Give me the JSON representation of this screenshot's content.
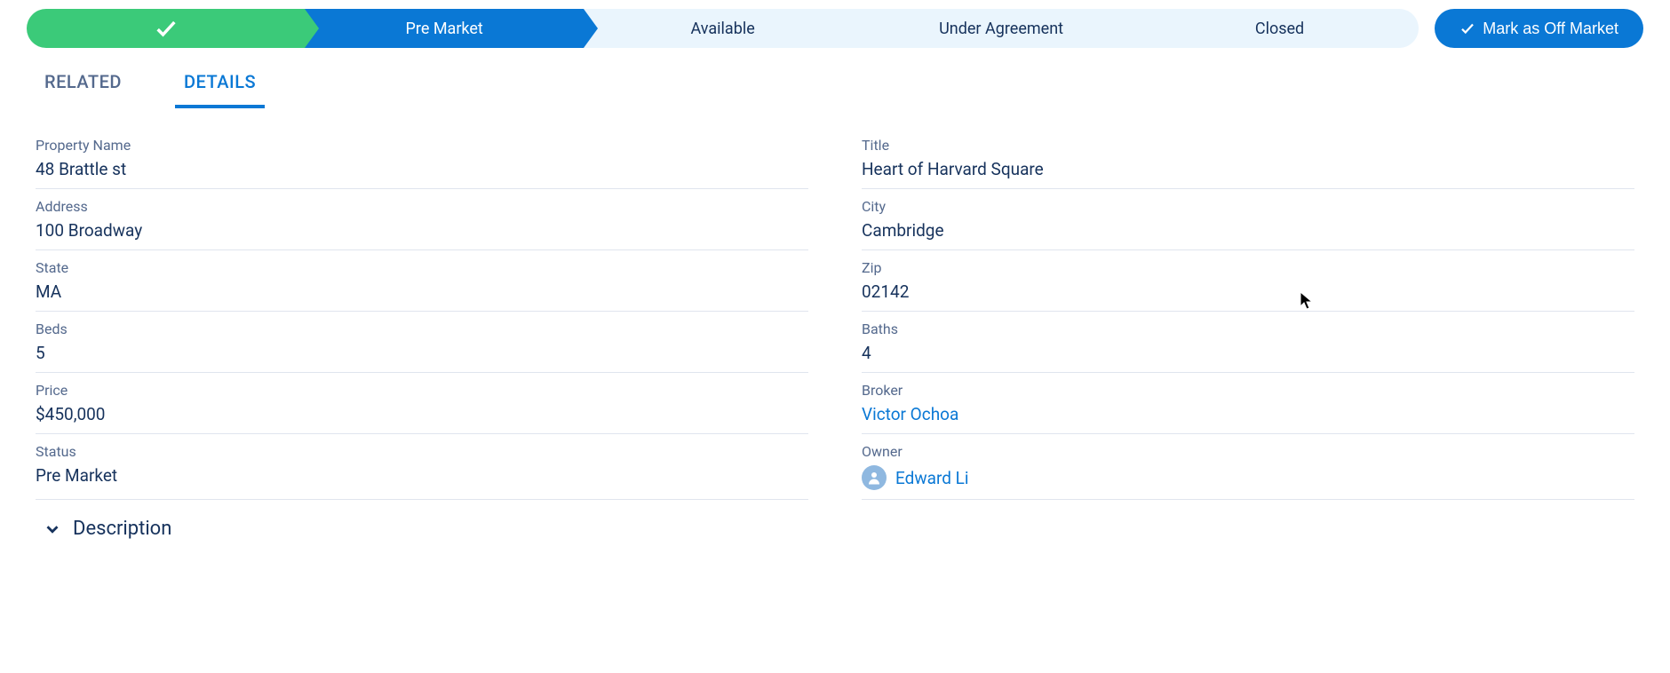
{
  "path": {
    "stages": [
      "",
      "Pre Market",
      "Available",
      "Under Agreement",
      "Closed"
    ],
    "complete_index": 0,
    "current_index": 1
  },
  "mark_button_label": "Mark as Off Market",
  "tabs": {
    "related": "RELATED",
    "details": "DETAILS"
  },
  "fields": {
    "property_name": {
      "label": "Property Name",
      "value": "48 Brattle st"
    },
    "title": {
      "label": "Title",
      "value": "Heart of Harvard Square"
    },
    "address": {
      "label": "Address",
      "value": "100 Broadway"
    },
    "city": {
      "label": "City",
      "value": "Cambridge"
    },
    "state": {
      "label": "State",
      "value": "MA"
    },
    "zip": {
      "label": "Zip",
      "value": "02142"
    },
    "beds": {
      "label": "Beds",
      "value": "5"
    },
    "baths": {
      "label": "Baths",
      "value": "4"
    },
    "price": {
      "label": "Price",
      "value": "$450,000"
    },
    "broker": {
      "label": "Broker",
      "value": "Victor Ochoa"
    },
    "status": {
      "label": "Status",
      "value": "Pre Market"
    },
    "owner": {
      "label": "Owner",
      "value": "Edward Li"
    }
  },
  "accordion": {
    "description_label": "Description"
  }
}
